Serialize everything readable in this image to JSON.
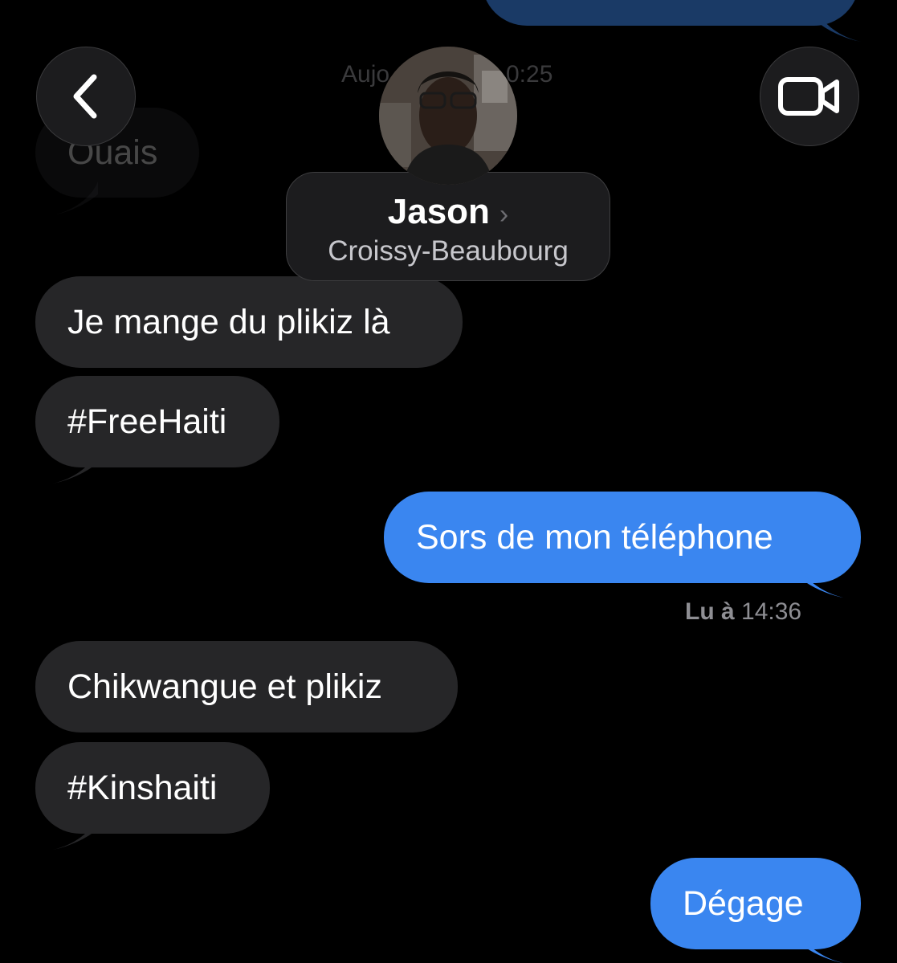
{
  "header": {
    "contact_name": "Jason",
    "contact_location": "Croissy-Beaubourg",
    "chevron": "›",
    "timestamp_partial": "Aujo",
    "timestamp_time": "0:25",
    "back_icon": "chevron-left-icon",
    "video_icon": "video-camera-icon"
  },
  "messages": [
    {
      "direction": "in",
      "text": "Ouais"
    },
    {
      "direction": "in",
      "text": "Je mange du plikiz là"
    },
    {
      "direction": "in",
      "text": "#FreeHaiti"
    },
    {
      "direction": "out",
      "text": "Sors de mon téléphone"
    },
    {
      "direction": "in",
      "text": "Chikwangue et plikiz"
    },
    {
      "direction": "in",
      "text": "#Kinshaiti"
    },
    {
      "direction": "out",
      "text": "Dégage"
    }
  ],
  "read_receipt": {
    "label": "Lu à",
    "time": "14:36"
  },
  "colors": {
    "background": "#000000",
    "incoming_bubble": "#262628",
    "outgoing_bubble": "#3a86f0",
    "receipt_text": "#8e8e93"
  }
}
